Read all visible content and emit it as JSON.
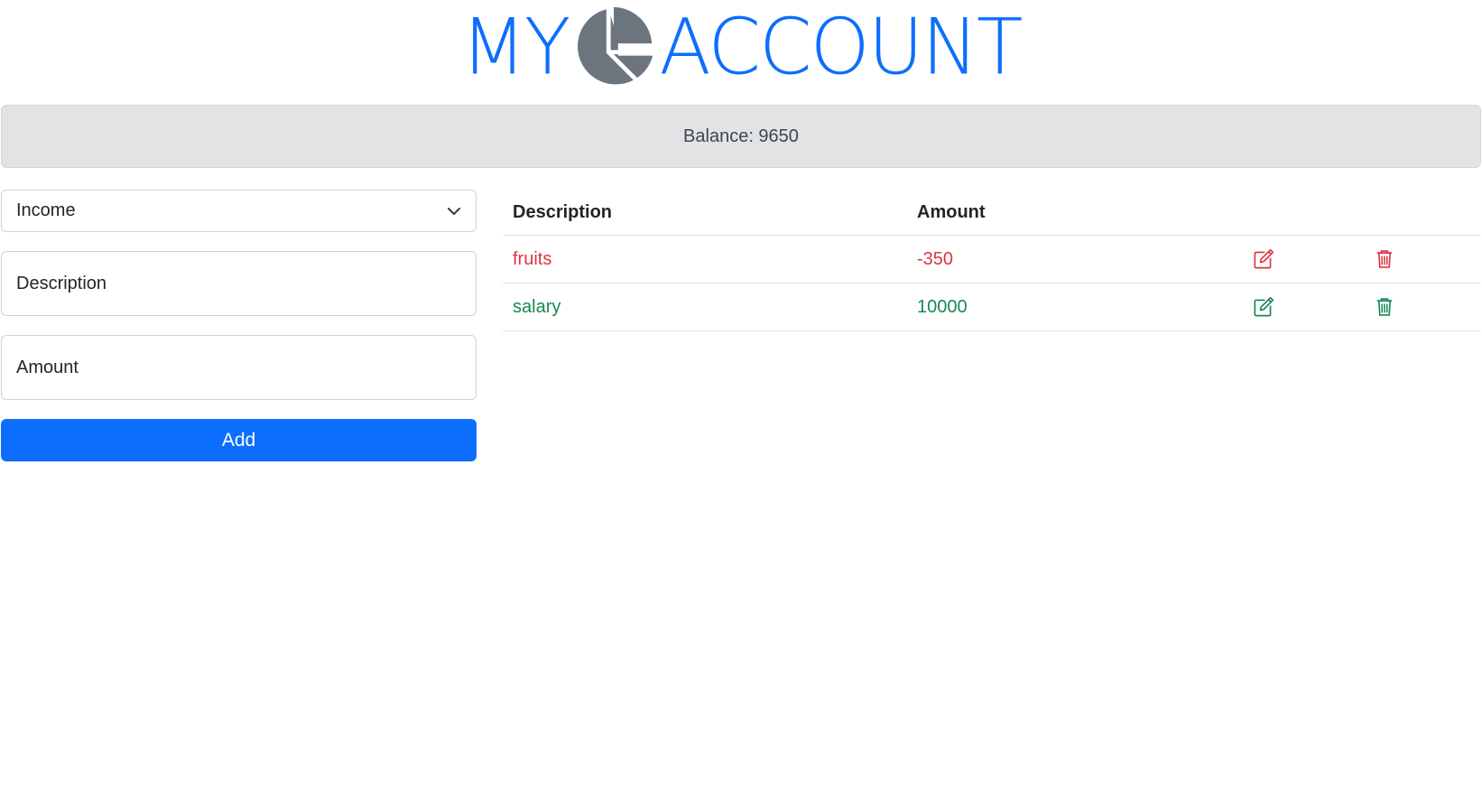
{
  "brand": {
    "left_text": "MY",
    "right_text": "ACCOUNT",
    "logo_icon": "pie-chart-icon"
  },
  "balance": {
    "text": "Balance: 9650"
  },
  "form": {
    "type_select": {
      "value": "Income"
    },
    "description": {
      "placeholder": "Description"
    },
    "amount": {
      "placeholder": "Amount"
    },
    "add_label": "Add"
  },
  "table": {
    "headers": {
      "description": "Description",
      "amount": "Amount"
    },
    "rows": [
      {
        "description": "fruits",
        "amount": "-350",
        "kind": "expense"
      },
      {
        "description": "salary",
        "amount": "10000",
        "kind": "income"
      }
    ]
  },
  "colors": {
    "primary": "#0d6efd",
    "expense": "#dc3545",
    "income": "#198754",
    "logo": "#6c757d"
  },
  "icons": {
    "edit": "edit-icon",
    "delete": "trash-icon",
    "dropdown": "chevron-down-icon"
  }
}
